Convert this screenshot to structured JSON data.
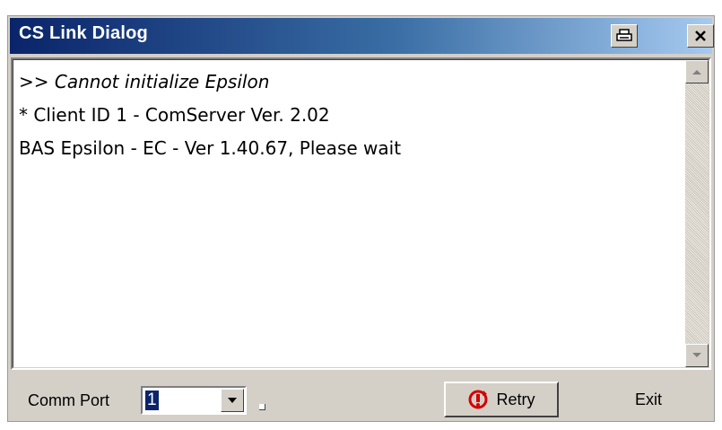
{
  "window": {
    "title": "CS Link Dialog"
  },
  "titlebar_buttons": {
    "print_icon": "print-icon",
    "close_icon": "close-icon"
  },
  "messages": [
    {
      "text": ">> Cannot initialize Epsilon",
      "italic": true
    },
    {
      "text": "* Client ID 1 - ComServer Ver. 2.02",
      "italic": false
    },
    {
      "text": "BAS Epsilon - EC - Ver 1.40.67, Please wait",
      "italic": false
    }
  ],
  "bottom": {
    "comm_port_label": "Comm Port",
    "comm_port_value": "1",
    "retry_label": "Retry",
    "exit_label": "Exit"
  },
  "colors": {
    "titlebar_start": "#0a246a",
    "titlebar_end": "#a6caf0",
    "retry_icon": "#d40000"
  }
}
